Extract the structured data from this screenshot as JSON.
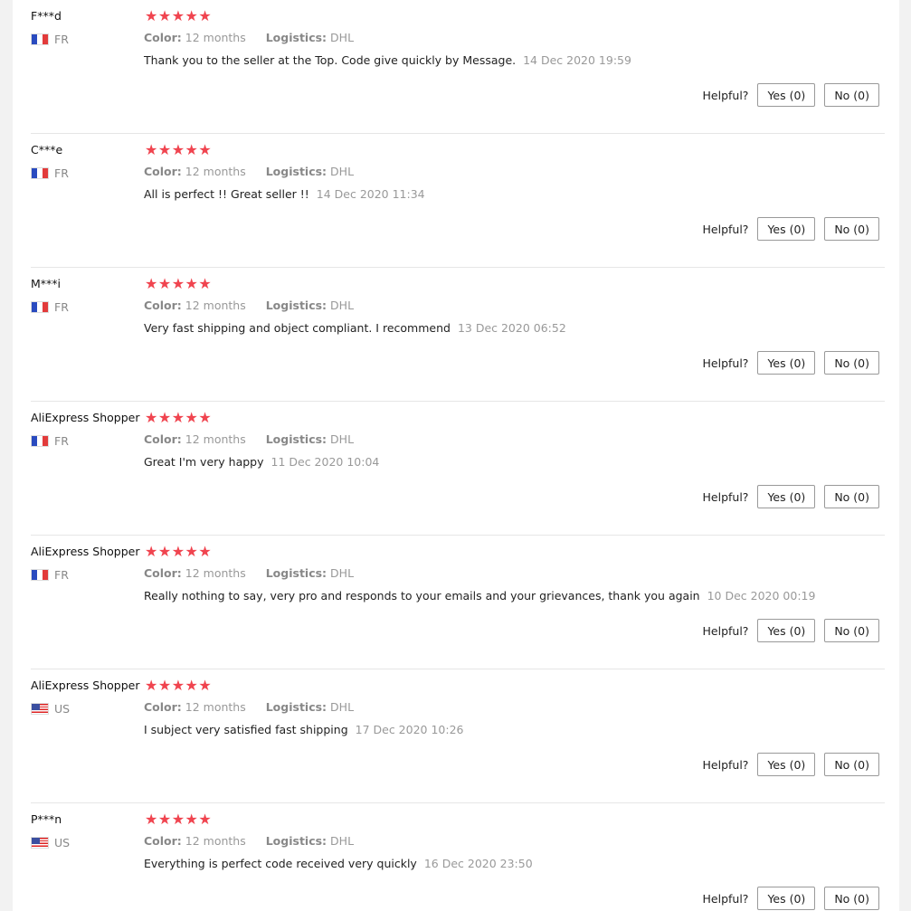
{
  "labels": {
    "color_key": "Color:",
    "logistics_key": "Logistics:",
    "helpful": "Helpful?",
    "yes": "Yes (0)",
    "no": "No (0)"
  },
  "colors": {
    "star": "#f0444f"
  },
  "reviews": [
    {
      "user": "F***d",
      "country": "FR",
      "rating": 5,
      "color": "12 months",
      "logistics": "DHL",
      "text": "Thank you to the seller at the Top. Code give quickly by Message.",
      "date": "14 Dec 2020 19:59"
    },
    {
      "user": "C***e",
      "country": "FR",
      "rating": 5,
      "color": "12 months",
      "logistics": "DHL",
      "text": "All is perfect !! Great seller !!",
      "date": "14 Dec 2020 11:34"
    },
    {
      "user": "M***i",
      "country": "FR",
      "rating": 5,
      "color": "12 months",
      "logistics": "DHL",
      "text": "Very fast shipping and object compliant. I recommend",
      "date": "13 Dec 2020 06:52"
    },
    {
      "user": "AliExpress Shopper",
      "country": "FR",
      "rating": 5,
      "color": "12 months",
      "logistics": "DHL",
      "text": "Great I'm very happy",
      "date": "11 Dec 2020 10:04"
    },
    {
      "user": "AliExpress Shopper",
      "country": "FR",
      "rating": 5,
      "color": "12 months",
      "logistics": "DHL",
      "text": "Really nothing to say, very pro and responds to your emails and your grievances, thank you again",
      "date": "10 Dec 2020 00:19"
    },
    {
      "user": "AliExpress Shopper",
      "country": "US",
      "rating": 5,
      "color": "12 months",
      "logistics": "DHL",
      "text": "I subject very satisfied fast shipping",
      "date": "17 Dec 2020 10:26"
    },
    {
      "user": "P***n",
      "country": "US",
      "rating": 5,
      "color": "12 months",
      "logistics": "DHL",
      "text": "Everything is perfect code received very quickly",
      "date": "16 Dec 2020 23:50"
    }
  ]
}
